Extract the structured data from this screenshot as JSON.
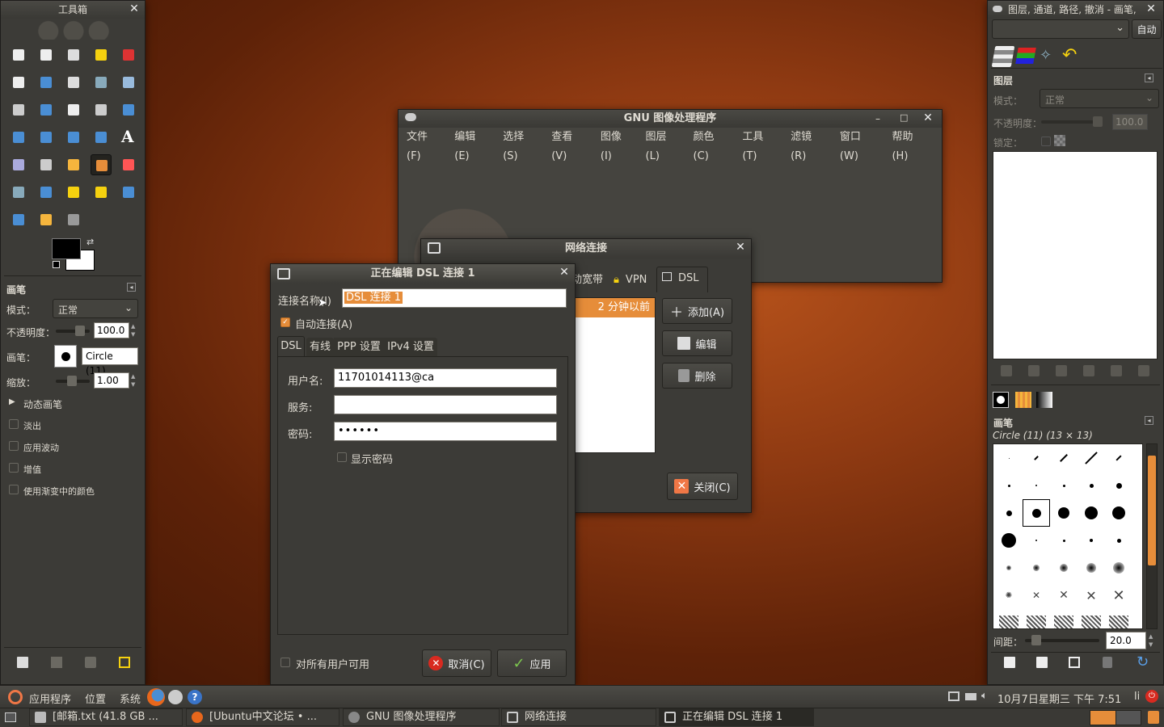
{
  "top_panel": {
    "apps": "应用程序",
    "places": "位置",
    "system": "系统",
    "clock": "10月7日星期三 下午 7:51",
    "user": "li"
  },
  "taskbar": [
    {
      "label": "[邮箱.txt (41.8 GB ..."
    },
    {
      "label": "[Ubuntu中文论坛 • ..."
    },
    {
      "label": "GNU 图像处理程序"
    },
    {
      "label": "网络连接"
    },
    {
      "label": "正在编辑 DSL 连接 1"
    }
  ],
  "toolbox": {
    "title": "工具箱",
    "brush_section": "画笔",
    "mode_label": "模式：",
    "mode_value": "正常",
    "opacity_label": "不透明度：",
    "opacity_value": "100.0",
    "brush_label": "画笔：",
    "brush_value": "Circle (11)",
    "scale_label": "缩放：",
    "scale_value": "1.00",
    "dynamics": "动态画笔",
    "options": [
      "淡出",
      "应用波动",
      "增值",
      "使用渐变中的颜色"
    ]
  },
  "layers": {
    "title": "图层, 通道, 路径, 撤消 - 画笔,",
    "auto_btn": "自动",
    "section": "图层",
    "mode_label": "模式：",
    "mode_value": "正常",
    "opacity_label": "不透明度：",
    "opacity_value": "100.0",
    "lock_label": "锁定：",
    "brushes_section": "画笔",
    "brush_name": "Circle (11) (13 × 13)",
    "spacing_label": "间距：",
    "spacing_value": "20.0"
  },
  "gimp_main": {
    "title": "GNU 图像处理程序",
    "menu": [
      "文件(F)",
      "编辑(E)",
      "选择(S)",
      "查看(V)",
      "图像(I)",
      "图层(L)",
      "颜色(C)",
      "工具(T)",
      "滤镜(R)",
      "窗口(W)",
      "帮助(H)"
    ]
  },
  "netconn": {
    "title": "网络连接",
    "tabs": [
      "动宽带",
      "VPN",
      "DSL"
    ],
    "row_time": "2 分钟以前",
    "add": "添加(A)",
    "edit": "编辑",
    "delete": "删除",
    "close": "关闭(C)"
  },
  "dsl": {
    "title": "正在编辑 DSL 连接 1",
    "name_label": "连接名称(I)",
    "name_value": "DSL 连接 1",
    "auto_connect": "自动连接(A)",
    "tabs": [
      "DSL",
      "有线",
      "PPP 设置",
      "IPv4 设置"
    ],
    "username_label": "用户名:",
    "username_value": "11701014113@ca",
    "service_label": "服务:",
    "service_value": "",
    "password_label": "密码:",
    "password_value": "••••••",
    "show_password": "显示密码",
    "all_users": "对所有用户可用",
    "cancel": "取消(C)",
    "apply": "应用"
  },
  "colors": {
    "accent": "#f07746",
    "panel": "#3c3b37",
    "selection": "#e68d3a"
  }
}
